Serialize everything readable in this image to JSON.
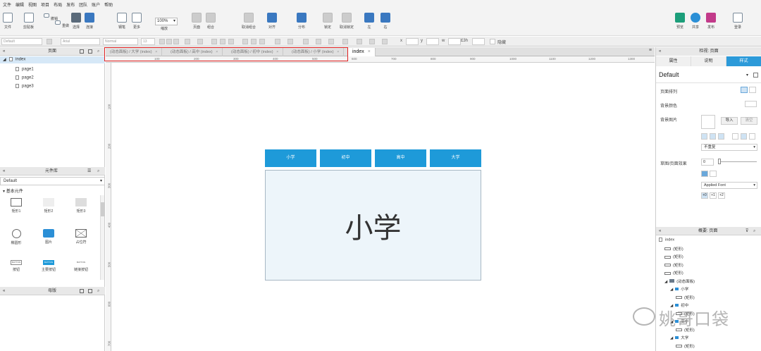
{
  "menu": [
    "文件",
    "编辑",
    "视图",
    "项目",
    "布局",
    "发布",
    "团队",
    "账户",
    "帮助"
  ],
  "toolbar": {
    "items": [
      {
        "label": "文件",
        "icon": "file-icon"
      },
      {
        "label": "剪贴板",
        "icon": "clipboard-icon"
      },
      {
        "label": "撤销",
        "icon": "undo-icon"
      },
      {
        "label": "重做",
        "icon": "redo-icon"
      },
      {
        "label": "选择",
        "icon": "select-icon"
      },
      {
        "label": "连接",
        "icon": "connect-icon"
      },
      {
        "label": "钢笔",
        "icon": "pen-icon"
      },
      {
        "label": "更多",
        "icon": "more-icon"
      },
      {
        "label": "缩放",
        "icon": "zoom-icon"
      },
      {
        "label": "页面",
        "icon": "page-icon"
      },
      {
        "label": "组合",
        "icon": "group-icon"
      },
      {
        "label": "取消组合",
        "icon": "ungroup-icon"
      },
      {
        "label": "对齐",
        "icon": "align-icon"
      },
      {
        "label": "分布",
        "icon": "distribute-icon"
      },
      {
        "label": "锁定",
        "icon": "lock-icon"
      },
      {
        "label": "取消锁定",
        "icon": "unlock-icon"
      },
      {
        "label": "左",
        "icon": "left-icon"
      },
      {
        "label": "右",
        "icon": "right-icon"
      },
      {
        "label": "预览",
        "icon": "preview-icon"
      },
      {
        "label": "共享",
        "icon": "share-icon"
      },
      {
        "label": "发布",
        "icon": "publish-icon"
      },
      {
        "label": "登录",
        "icon": "login-icon"
      }
    ],
    "zoom_value": "100%"
  },
  "format": {
    "style": "Default",
    "font": "Arial",
    "weight": "Normal",
    "size": "13",
    "x_label": "x",
    "y_label": "y",
    "w_label": "w",
    "h_label": "£3h",
    "hidden_label": "隐藏"
  },
  "pages_panel": {
    "title": "页面",
    "root": "index",
    "children": [
      "page1",
      "page2",
      "page3"
    ]
  },
  "library_panel": {
    "title": "元件库",
    "selected": "Default",
    "group": "基本元件",
    "widgets": [
      {
        "label": "矩形1",
        "shape": "rect"
      },
      {
        "label": "矩形2",
        "shape": "rect-gray"
      },
      {
        "label": "矩形3",
        "shape": "rect-gray2"
      },
      {
        "label": "椭圆形",
        "shape": "ellipse"
      },
      {
        "label": "图片",
        "shape": "image"
      },
      {
        "label": "占位符",
        "shape": "placeholder"
      },
      {
        "label": "按钮",
        "shape": "button",
        "text": "BUTTON"
      },
      {
        "label": "主要按钮",
        "shape": "primary-button",
        "text": "BUTTON"
      },
      {
        "label": "链接按钮",
        "shape": "link-button",
        "text": "BUTTON"
      }
    ]
  },
  "masters_panel": {
    "title": "母版"
  },
  "tabs": [
    {
      "label": "(动态面板) / 大学 (index)"
    },
    {
      "label": "(动态面板) / 高中 (index)"
    },
    {
      "label": "(动态面板) / 初中 (index)"
    },
    {
      "label": "(动态面板) / 小学 (index)"
    },
    {
      "label": "index",
      "active": true
    }
  ],
  "ruler_marks": [
    "100",
    "200",
    "300",
    "400",
    "500",
    "600",
    "700",
    "800",
    "900",
    "1000",
    "1100",
    "1200",
    "1300"
  ],
  "vruler_marks": [
    "100",
    "200",
    "300",
    "400",
    "500",
    "600",
    "700"
  ],
  "canvas": {
    "buttons": [
      "小学",
      "初中",
      "高中",
      "大学"
    ],
    "panel_text": "小学",
    "button_color": "#1e9ad9"
  },
  "inspector": {
    "title": "检视: 页面",
    "tabs": [
      "属性",
      "说明",
      "样式"
    ],
    "active_tab": "样式",
    "style_name": "Default",
    "labels": {
      "page_align": "页面排列",
      "bg_color": "背景颜色",
      "bg_image": "背景图片",
      "import": "导入",
      "clear": "清空",
      "repeat": "不重复",
      "sketch": "草图/页面效果",
      "sketch_value": "0",
      "font": "Applied Font",
      "plus1": "+1",
      "plus2": "+2"
    }
  },
  "outline": {
    "title": "概要: 页面",
    "items": [
      {
        "label": "index",
        "level": 0
      },
      {
        "label": "(矩形)",
        "level": 1
      },
      {
        "label": "(矩形)",
        "level": 1
      },
      {
        "label": "(矩形)",
        "level": 1
      },
      {
        "label": "(矩形)",
        "level": 1
      },
      {
        "label": "(动态面板)",
        "level": 1
      },
      {
        "label": "小学",
        "level": 2
      },
      {
        "label": "(矩形)",
        "level": 3
      },
      {
        "label": "初中",
        "level": 2
      },
      {
        "label": "(矩形)",
        "level": 3
      },
      {
        "label": "高中",
        "level": 2
      },
      {
        "label": "(矩形)",
        "level": 3
      },
      {
        "label": "大学",
        "level": 2
      },
      {
        "label": "(矩形)",
        "level": 3
      }
    ]
  },
  "watermark": "姚哥口袋"
}
